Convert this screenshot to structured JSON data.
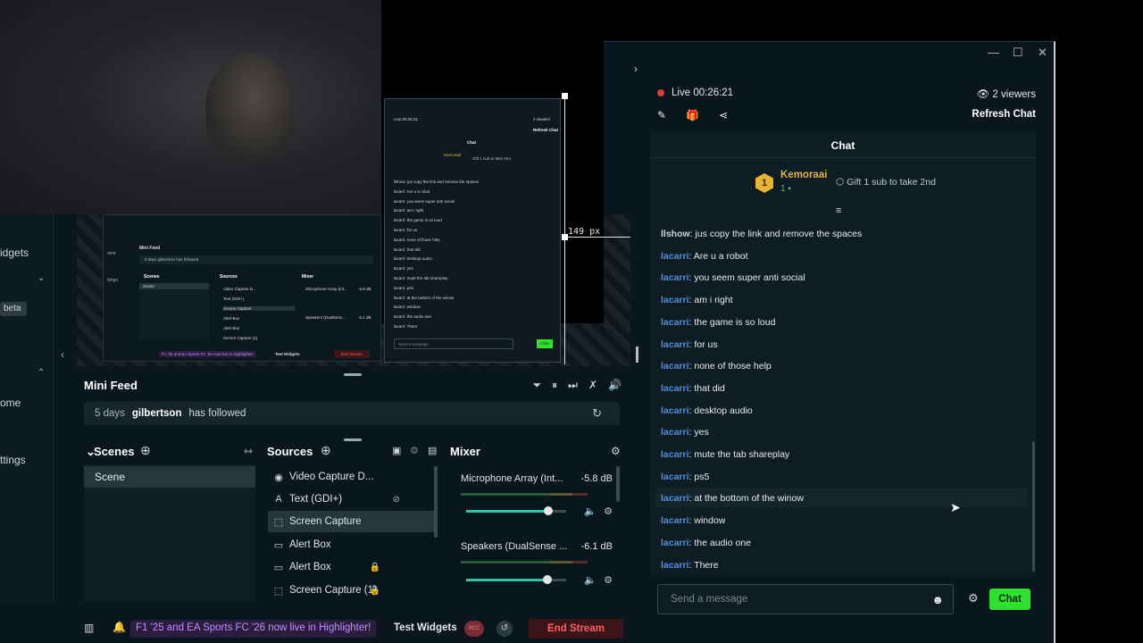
{
  "window": {
    "minimize": "—",
    "maximize": "☐",
    "close": "✕"
  },
  "left_nav": {
    "widgets": "idgets",
    "beta": "beta",
    "home": "ome",
    "settings": "ttings"
  },
  "preview": {
    "px_label": "149 px"
  },
  "nested_chat": {
    "header_live": "Live 00:26:21",
    "header_viewers": "2 viewers",
    "refresh": "Refresh Chat",
    "title": "Chat",
    "top_user": "Kemoraai",
    "gift": "Gift 1 sub to take 2nd",
    "lines": [
      "llshow: jus copy the link and remove the spaces",
      "lacarri: Are u a robot",
      "lacarri: you seem super anti social",
      "lacarri: am i right",
      "lacarri: the game is so loud",
      "lacarri: for us",
      "lacarri: none of those help",
      "lacarri: that did",
      "lacarri: desktop audio",
      "lacarri: yes",
      "lacarri: mute the tab shareplay",
      "lacarri: ps5",
      "lacarri: at the bottom of the winow",
      "lacarri: window",
      "lacarri: the audio one",
      "lacarri: There"
    ],
    "input_placeholder": "Send a message",
    "chat_button": "Chat"
  },
  "nested_studio": {
    "mini_feed": "Mini Feed",
    "feed_row": "5 days gilbertson has followed",
    "scenes": "Scenes",
    "scene": "Scene",
    "sources": "Sources",
    "mixer": "Mixer",
    "src_items": [
      "Video Capture D...",
      "Text (GDI+)",
      "Screen Capture",
      "Alert Box",
      "Alert Box",
      "Screen Capture (1)"
    ],
    "mix_items": [
      "Microphone Array (Int...",
      "-5.8 dB",
      "Speakers (DualSens...",
      "-6.1 dB"
    ],
    "promo": "F1 '25 and EA Sports FC '26 now live in Highlighter!",
    "test_widgets": "Test Widgets",
    "end_stream": "End Stream",
    "home": "ome",
    "settings": "ttings"
  },
  "mini_feed": {
    "title": "Mini Feed",
    "entry": {
      "time": "5 days",
      "user": "gilbertson",
      "action": "has followed"
    }
  },
  "scenes": {
    "title": "Scenes",
    "items": [
      "Scene"
    ]
  },
  "sources": {
    "title": "Sources",
    "items": [
      {
        "label": "Video Capture D...",
        "icon": "camera-icon"
      },
      {
        "label": "Text (GDI+)",
        "icon": "text-icon"
      },
      {
        "label": "Screen Capture",
        "icon": "screen-capture-icon"
      },
      {
        "label": "Alert Box",
        "icon": "alert-box-icon"
      },
      {
        "label": "Alert Box",
        "icon": "alert-box-icon"
      },
      {
        "label": "Screen Capture (1)",
        "icon": "screen-capture-icon"
      }
    ]
  },
  "mixer": {
    "title": "Mixer",
    "channels": [
      {
        "name": "Microphone Array (Int...",
        "db": "-5.8 dB",
        "volume": 0.82
      },
      {
        "name": "Speakers (DualSense ...",
        "db": "-6.1 dB",
        "volume": 0.81
      }
    ]
  },
  "footer": {
    "promo": "F1 '25 and EA Sports FC '26 now live in Highlighter!",
    "test_widgets": "Test Widgets",
    "rec": "REC",
    "end_stream": "End Stream"
  },
  "chat_header": {
    "live": "Live",
    "timer": "00:26:21",
    "viewers": "2 viewers",
    "refresh": "Refresh Chat"
  },
  "chat": {
    "title": "Chat",
    "top_supporter": {
      "rank": "1",
      "name": "Kemoraai",
      "count": "1"
    },
    "gift_text": "Gift 1 sub to take 2nd",
    "messages": [
      {
        "user": "llshow",
        "text": ": jus copy the link and remove the spaces"
      },
      {
        "user": "lacarri",
        "text": ": Are u a robot"
      },
      {
        "user": "lacarri",
        "text": ": you seem super anti social"
      },
      {
        "user": "lacarri",
        "text": ": am i right"
      },
      {
        "user": "lacarri",
        "text": ": the game is so loud"
      },
      {
        "user": "lacarri",
        "text": ": for us"
      },
      {
        "user": "lacarri",
        "text": ": none of those help"
      },
      {
        "user": "lacarri",
        "text": ": that did"
      },
      {
        "user": "lacarri",
        "text": ": desktop audio"
      },
      {
        "user": "lacarri",
        "text": ": yes"
      },
      {
        "user": "lacarri",
        "text": ": mute the tab shareplay"
      },
      {
        "user": "lacarri",
        "text": ": ps5"
      },
      {
        "user": "lacarri",
        "text": ": at the bottom of the winow"
      },
      {
        "user": "lacarri",
        "text": ": window"
      },
      {
        "user": "lacarri",
        "text": ": the audio one"
      },
      {
        "user": "lacarri",
        "text": ": There"
      }
    ],
    "input_placeholder": "Send a message",
    "send_button": "Chat"
  },
  "colors": {
    "accent_green": "#2fe02f",
    "live_red": "#e53935",
    "username_blue": "#4f8fe6",
    "end_stream_red": "#ff5f5f"
  }
}
